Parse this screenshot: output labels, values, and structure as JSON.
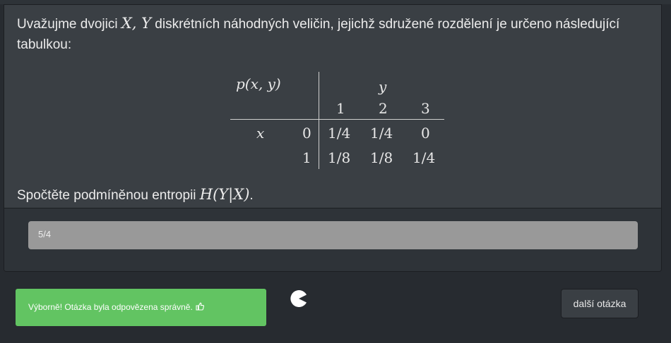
{
  "question": {
    "intro_before": "Uvažujme dvojici ",
    "intro_vars": "X, Y",
    "intro_after": " diskrétních náhodných veličin, jejichž sdružené rozdělení je určeno následující tabulkou:",
    "table": {
      "corner_label": "p(x, y)",
      "col_var": "y",
      "row_var": "x",
      "col_values": [
        "1",
        "2",
        "3"
      ],
      "row_values": [
        "0",
        "1"
      ],
      "cells": [
        [
          "1/4",
          "1/4",
          "0"
        ],
        [
          "1/8",
          "1/8",
          "1/4"
        ]
      ]
    },
    "prompt_before": "Spočtěte podmíněnou entropii ",
    "prompt_math": "H(Y|X)",
    "prompt_after": "."
  },
  "answer": {
    "value": "5/4"
  },
  "feedback": {
    "message": "Výborně! Otázka byla odpovězena správně.",
    "icon": "thumbs-up-icon",
    "color": "#62c462"
  },
  "actions": {
    "next_label": "další otázka"
  },
  "colors": {
    "background": "#272b30",
    "card": "#3a3f44",
    "input": "#999999"
  }
}
